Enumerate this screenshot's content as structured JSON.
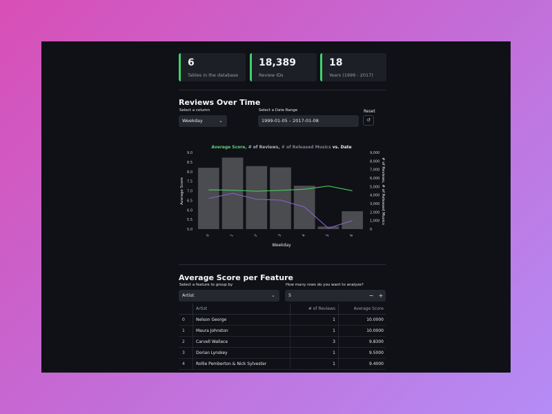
{
  "metrics": [
    {
      "value": "6",
      "label": "Tables in the database"
    },
    {
      "value": "18,389",
      "label": "Review IDs"
    },
    {
      "value": "18",
      "label": "Years (1999 - 2017)"
    }
  ],
  "reviews_section": {
    "title": "Reviews Over Time",
    "column_label": "Select a column",
    "column_value": "Weekday",
    "date_label": "Select a Date Range",
    "date_value": "1999-01-05 – 2017-01-08",
    "reset_label": "Reset",
    "reset_icon": "reset-icon"
  },
  "chart_data": {
    "type": "bar+line",
    "title_parts": [
      "Average Score",
      ", ",
      "# of Reviews",
      ", ",
      "# of Released Musics",
      " vs. Date"
    ],
    "title_colors": [
      "#5fd37a",
      "#9a9ea6",
      "#b2b5bb",
      "#9a9ea6",
      "#7e8188",
      "#e8eaee"
    ],
    "xlabel": "Weekday",
    "ylabel_left": "Average Score",
    "ylabel_right": "# of Reviews, # of Released Musics",
    "categories": [
      "0",
      "1",
      "2",
      "3",
      "4",
      "5",
      "6"
    ],
    "left_ylim": [
      5.0,
      9.0
    ],
    "left_ticks": [
      "5.0",
      "5.5",
      "6.0",
      "6.5",
      "7.0",
      "7.5",
      "8.0",
      "8.5",
      "9.0"
    ],
    "right_ylim": [
      0,
      9000
    ],
    "right_ticks": [
      "0",
      "1,000",
      "2,000",
      "3,000",
      "4,000",
      "5,000",
      "6,000",
      "7,000",
      "8,000",
      "9,000"
    ],
    "series": [
      {
        "name": "# of Released Musics",
        "type": "bar",
        "axis": "right",
        "color": "#4a4c50",
        "values": [
          7200,
          8400,
          7400,
          7250,
          5100,
          300,
          2100
        ]
      },
      {
        "name": "Average Score",
        "type": "line",
        "axis": "left",
        "color": "#4cc35c",
        "values": [
          7.05,
          7.03,
          6.98,
          7.02,
          7.08,
          7.25,
          7.0
        ]
      },
      {
        "name": "# of Reviews",
        "type": "line",
        "axis": "right",
        "color": "#8a5cc4",
        "values": [
          3600,
          4200,
          3500,
          3400,
          2600,
          100,
          1000
        ]
      }
    ]
  },
  "feature_section": {
    "title": "Average Score per Feature",
    "group_label": "Select a feature to group by",
    "group_value": "Artist",
    "rows_label": "How many rows do you want to analyze?",
    "rows_value": "5",
    "minus_label": "−",
    "plus_label": "+"
  },
  "table": {
    "headers": [
      "",
      "Artist",
      "# of Reviews",
      "Average Score"
    ],
    "rows": [
      [
        "0",
        "Nelson George",
        "1",
        "10.0000"
      ],
      [
        "1",
        "Maura Johnston",
        "1",
        "10.0000"
      ],
      [
        "2",
        "Carvell Wallace",
        "3",
        "9.8300"
      ],
      [
        "3",
        "Dorian Lynskey",
        "1",
        "9.5000"
      ],
      [
        "4",
        "Rollie Pemberton & Nick Sylvester",
        "1",
        "9.4000"
      ]
    ]
  }
}
